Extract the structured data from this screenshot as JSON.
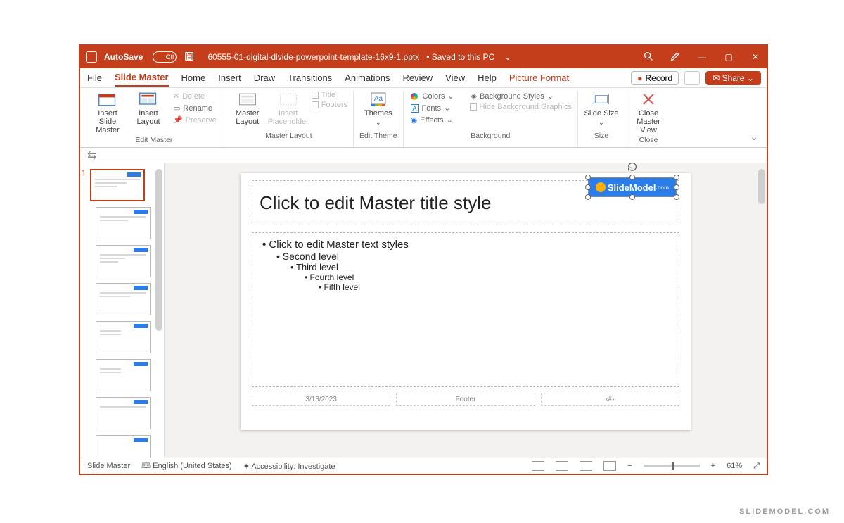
{
  "titlebar": {
    "autosave_label": "AutoSave",
    "autosave_state": "Off",
    "filename": "60555-01-digital-divide-powerpoint-template-16x9-1.pptx",
    "save_status": "Saved to this PC"
  },
  "tabs": {
    "file": "File",
    "slide_master": "Slide Master",
    "home": "Home",
    "insert": "Insert",
    "draw": "Draw",
    "transitions": "Transitions",
    "animations": "Animations",
    "review": "Review",
    "view": "View",
    "help": "Help",
    "picture_format": "Picture Format",
    "record": "Record",
    "share": "Share"
  },
  "ribbon": {
    "edit_master": {
      "insert_slide_master": "Insert Slide Master",
      "insert_layout": "Insert Layout",
      "delete": "Delete",
      "rename": "Rename",
      "preserve": "Preserve",
      "group": "Edit Master"
    },
    "master_layout_grp": {
      "master_layout": "Master Layout",
      "insert_placeholder": "Insert Placeholder",
      "title_chk": "Title",
      "footers_chk": "Footers",
      "group": "Master Layout"
    },
    "edit_theme": {
      "themes": "Themes",
      "group": "Edit Theme"
    },
    "background": {
      "colors": "Colors",
      "fonts": "Fonts",
      "effects": "Effects",
      "bg_styles": "Background Styles",
      "hide_bg": "Hide Background Graphics",
      "group": "Background"
    },
    "size": {
      "slide_size": "Slide Size",
      "group": "Size"
    },
    "close": {
      "close_master": "Close Master View",
      "group": "Close"
    }
  },
  "slide": {
    "number": "1",
    "title_placeholder": "Click to edit Master title style",
    "body_l1": "Click to edit Master text styles",
    "body_l2": "Second level",
    "body_l3": "Third level",
    "body_l4": "Fourth level",
    "body_l5": "Fifth level",
    "date": "3/13/2023",
    "footer": "Footer",
    "pagenum": "‹#›",
    "logo_text": "SlideModel"
  },
  "statusbar": {
    "view_label": "Slide Master",
    "language": "English (United States)",
    "accessibility": "Accessibility: Investigate",
    "zoom": "61%"
  },
  "watermark": "SLIDEMODEL.COM"
}
